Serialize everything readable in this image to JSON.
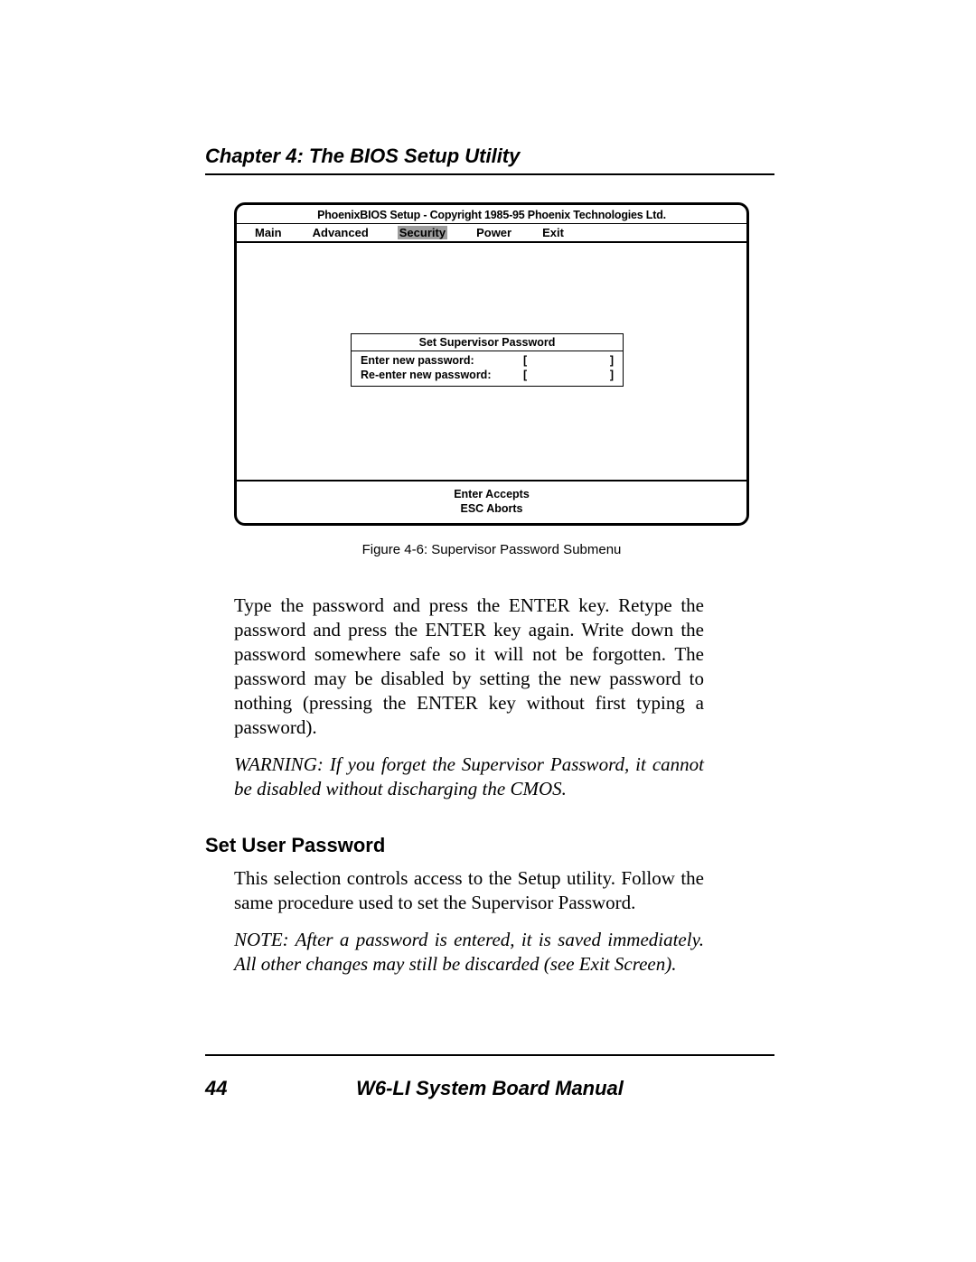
{
  "header": {
    "chapter_title": "Chapter 4: The BIOS Setup Utility"
  },
  "bios": {
    "title": "PhoenixBIOS Setup - Copyright 1985-95 Phoenix Technologies Ltd.",
    "tabs": {
      "main": "Main",
      "advanced": "Advanced",
      "security": "Security",
      "power": "Power",
      "exit": "Exit"
    },
    "password_box": {
      "title": "Set Supervisor Password",
      "row1_label": "Enter new password:",
      "row2_label": "Re-enter new password:",
      "bracket_left": "[",
      "bracket_right": "]"
    },
    "footer": {
      "line1": "Enter Accepts",
      "line2": "ESC Aborts"
    }
  },
  "caption": "Figure 4-6: Supervisor Password Submenu",
  "paragraphs": {
    "p1": "Type the password and press the ENTER key. Retype the password and press the ENTER key again. Write down the password somewhere safe so it will not be forgotten. The password may be disabled by setting the new password to nothing (pressing the ENTER key without first typing a password).",
    "warning": "WARNING: If you forget the Supervisor Password, it cannot be disabled without discharging the CMOS."
  },
  "section2": {
    "heading": "Set User Password",
    "p1": "This selection controls access to the Setup utility. Follow the same procedure used to set the Supervisor Password.",
    "note": "NOTE: After a password is entered, it is saved immediately. All other changes may still be discarded (see Exit Screen)."
  },
  "footer": {
    "page_number": "44",
    "manual": "W6-LI System Board Manual"
  }
}
